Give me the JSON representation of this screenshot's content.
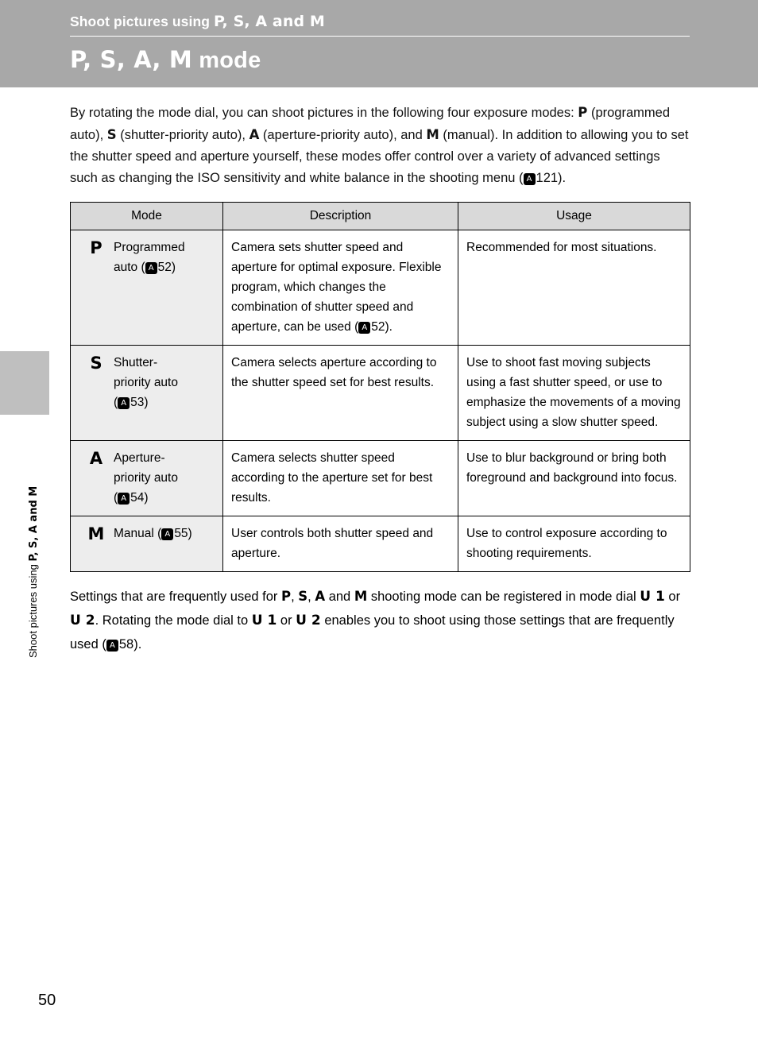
{
  "header": {
    "chapter_title_prefix": "Shoot pictures using ",
    "chapter_modes": "P, S, A and M",
    "page_title_modes": "P, S, A, M",
    "page_title_suffix": " mode"
  },
  "side_tab": {
    "label_prefix": "Shoot pictures using ",
    "label_modes": "P, S, A and M"
  },
  "intro": {
    "line": "By rotating the mode dial, you can shoot pictures in the following four exposure modes: P (programmed auto), S (shutter-priority auto), A (aperture-priority auto), and M (manual). In addition to allowing you to set the shutter speed and aperture yourself, these modes offer control over a variety of advanced settings such as changing the ISO sensitivity and white balance in the shooting menu (A121).",
    "seg1": "By rotating the mode dial, you can shoot pictures in the following four exposure modes: ",
    "m_p": "P",
    "seg2": " (programmed auto), ",
    "m_s": "S",
    "seg3": " (shutter-priority auto), ",
    "m_a": "A",
    "seg4": " (aperture-priority auto), and ",
    "m_m": "M",
    "seg5": " (manual). In addition to allowing you to set the shutter speed and aperture yourself, these modes offer control over a variety of advanced settings such as changing the ISO sensitivity and white balance in the shooting menu (",
    "ref_icon": "A",
    "ref_page": "121).",
    "seg6": ""
  },
  "table": {
    "headers": [
      "Mode",
      "Description",
      "Usage"
    ],
    "rows": [
      {
        "letter": "P",
        "name_line1": "Programmed",
        "name_line2_pre": "auto (",
        "name_ref_icon": "A",
        "name_ref": "52)",
        "description_pre": "Camera sets shutter speed and aperture for optimal exposure. Flexible program, which changes the combination of shutter speed and aperture, can be used (",
        "description_ref_icon": "A",
        "description_ref": "52).",
        "usage": "Recommended for most situations."
      },
      {
        "letter": "S",
        "name_line1": "Shutter-",
        "name_line2": "priority auto",
        "name_line3_pre": "(",
        "name_ref_icon": "A",
        "name_ref": "53)",
        "description_pre": "Camera selects aperture according to the shutter speed set for best results.",
        "usage": "Use to shoot fast moving subjects using a fast shutter speed, or use to emphasize the movements of a moving subject using a slow shutter speed."
      },
      {
        "letter": "A",
        "name_line1": "Aperture-",
        "name_line2": "priority auto",
        "name_line3_pre": "(",
        "name_ref_icon": "A",
        "name_ref": "54)",
        "description_pre": "Camera selects shutter speed according to the aperture set for best results.",
        "usage": "Use to blur background or bring both foreground and background into focus."
      },
      {
        "letter": "M",
        "name_line1_pre": "Manual (",
        "name_ref_icon": "A",
        "name_ref": "55)",
        "description_pre": "User controls both shutter speed and aperture.",
        "usage": "Use to control exposure according to shooting requirements."
      }
    ]
  },
  "after": {
    "seg1": "Settings that are frequently used for ",
    "m_p": "P",
    "seg2": ", ",
    "m_s": "S",
    "seg3": ", ",
    "m_a": "A",
    "seg4": " and ",
    "m_m": "M",
    "seg5": " shooting mode can be registered in mode dial ",
    "u1a": "U 1",
    "seg6": " or ",
    "u2a": "U 2",
    "seg7": ". Rotating the mode dial to ",
    "u1b": "U 1",
    "seg8": " or ",
    "u2b": "U 2",
    "seg9": " enables you to shoot using those settings that are frequently used (",
    "ref_icon": "A",
    "ref_page": "58)."
  },
  "footer": {
    "page_number": "50"
  },
  "colors": {
    "header_band": "#a8a8a8",
    "side_tab": "#bfbfbf",
    "table_header": "#d9d9d9",
    "mode_cell": "#ededed"
  }
}
